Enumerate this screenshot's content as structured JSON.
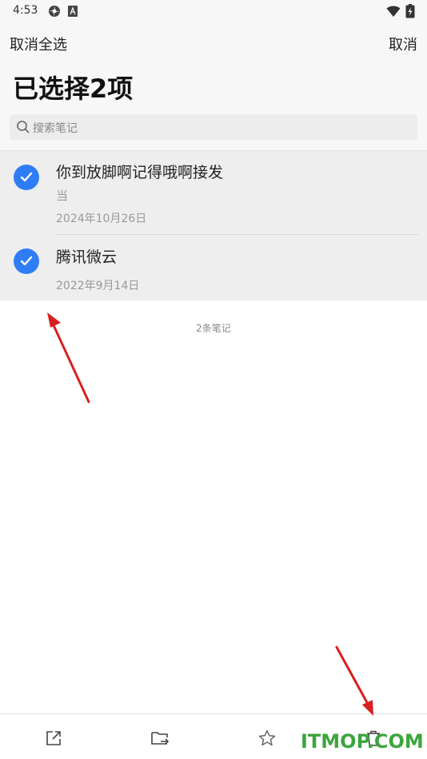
{
  "status_bar": {
    "time": "4:53",
    "icons": [
      "settings-flower-icon",
      "font-a-icon",
      "wifi-icon",
      "battery-charging-icon"
    ]
  },
  "header": {
    "left_action": "取消全选",
    "right_action": "取消",
    "title": "已选择2项"
  },
  "search": {
    "placeholder": "搜索笔记",
    "icon": "search-icon"
  },
  "notes": [
    {
      "title": "你到放脚啊记得哦啊接发",
      "preview": "当",
      "date": "2024年10月26日",
      "selected": true
    },
    {
      "title": "腾讯微云",
      "preview": "",
      "date": "2022年9月14日",
      "selected": true
    }
  ],
  "footer": {
    "count": "2条笔记"
  },
  "toolbar": {
    "icons": [
      "share-icon",
      "move-folder-icon",
      "star-icon",
      "delete-icon"
    ]
  },
  "watermark": "ITMOP.COM",
  "colors": {
    "accent": "#2f7df6",
    "arrow": "#d92020",
    "watermark": "#3ca53c"
  }
}
